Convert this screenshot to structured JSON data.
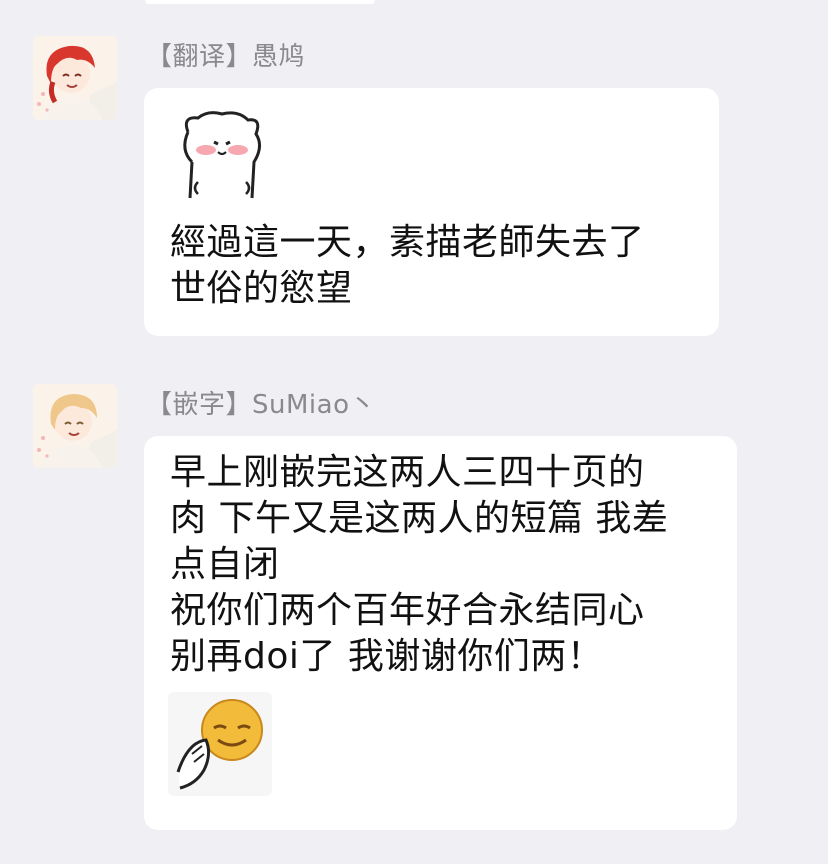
{
  "messages": [
    {
      "sender": "【翻译】愚鸠",
      "avatar": "red-hair-anime-avatar",
      "sticker_top": "white-bear-blushing-sticker",
      "text": "經過這一天，素描老師失去了\n世俗的慾望"
    },
    {
      "sender": "【嵌字】SuMiao丶",
      "avatar": "blonde-anime-avatar",
      "text": "早上刚嵌完这两人三四十页的\n肉 下午又是这两人的短篇 我差\n点自闭\n祝你们两个百年好合永结同心\n别再doi了 我谢谢你们两！",
      "sticker_bottom": "praying-smiley-sticker"
    }
  ]
}
